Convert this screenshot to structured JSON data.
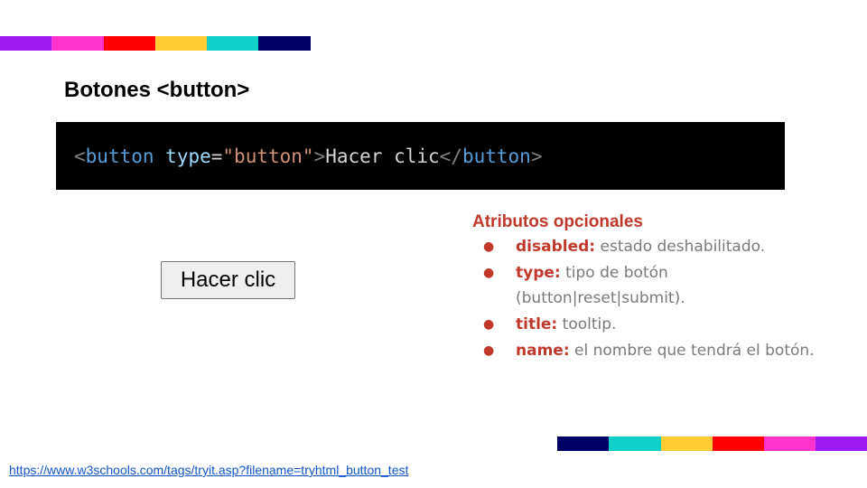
{
  "slide": {
    "title": "Botones <button>",
    "stripe_colors": [
      "#9b1bf0",
      "#ff33cc",
      "#ff0000",
      "#ffcc33",
      "#0fd0c8",
      "#000066"
    ],
    "code": {
      "tokens": [
        {
          "text": "<",
          "color": "#808080"
        },
        {
          "text": "button",
          "color": "#569cd6"
        },
        {
          "text": " ",
          "color": "#d4d4d4"
        },
        {
          "text": "type",
          "color": "#9cdcfe"
        },
        {
          "text": "=",
          "color": "#d4d4d4"
        },
        {
          "text": "\"button\"",
          "color": "#ce9178"
        },
        {
          "text": ">",
          "color": "#808080"
        },
        {
          "text": "Hacer clic",
          "color": "#d4d4d4"
        },
        {
          "text": "</",
          "color": "#808080"
        },
        {
          "text": "button",
          "color": "#569cd6"
        },
        {
          "text": ">",
          "color": "#808080"
        }
      ]
    },
    "demo_button_label": "Hacer clic",
    "attributes": {
      "heading": "Atributos opcionales",
      "accent_color": "#c0392b",
      "bullet": "●",
      "items": [
        {
          "name": "disabled:",
          "desc": " estado deshabilitado.",
          "desc2": ""
        },
        {
          "name": "type:",
          "desc": " tipo de botón",
          "desc2": "(button|reset|submit)."
        },
        {
          "name": "title:",
          "desc": " tooltip.",
          "desc2": ""
        },
        {
          "name": "name:",
          "desc": " el nombre que tendrá el botón.",
          "desc2": ""
        }
      ]
    },
    "source_link": "https://www.w3schools.com/tags/tryit.asp?filename=tryhtml_button_test"
  }
}
